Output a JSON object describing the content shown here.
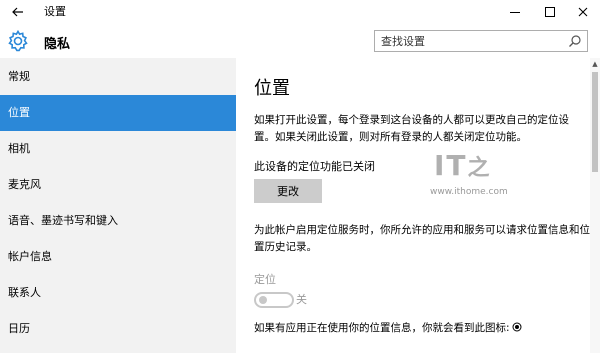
{
  "window": {
    "title": "设置",
    "back_icon": "back-arrow-icon",
    "minimize_icon": "minimize-icon",
    "maximize_icon": "maximize-icon",
    "close_icon": "close-icon"
  },
  "header": {
    "title": "隐私",
    "icon": "gear-icon"
  },
  "search": {
    "placeholder": "查找设置",
    "icon": "search-icon"
  },
  "sidebar": {
    "items": [
      {
        "label": "常规",
        "selected": false
      },
      {
        "label": "位置",
        "selected": true
      },
      {
        "label": "相机",
        "selected": false
      },
      {
        "label": "麦克风",
        "selected": false
      },
      {
        "label": "语音、墨迹书写和键入",
        "selected": false
      },
      {
        "label": "帐户信息",
        "selected": false
      },
      {
        "label": "联系人",
        "selected": false
      },
      {
        "label": "日历",
        "selected": false
      }
    ]
  },
  "main": {
    "title": "位置",
    "description1": "如果打开此设置，每个登录到这台设备的人都可以更改自己的定位设置。如果关闭此设置，则对所有登录的人都关闭定位功能。",
    "status_text": "此设备的定位功能已关闭",
    "change_button": "更改",
    "description2": "为此帐户启用定位服务时，你所允许的应用和服务可以请求位置信息和位置历史记录。",
    "location_label": "定位",
    "toggle_state": "关",
    "description3": "如果有应用正在使用你的位置信息，你就会看到此图标:"
  },
  "watermark": {
    "logo": "IT之家",
    "url": "www.ithome.com"
  },
  "colors": {
    "accent": "#2b88d8",
    "sidebar_bg": "#f2f2f2",
    "button_bg": "#cccccc",
    "disabled_text": "#9a9a9a"
  }
}
